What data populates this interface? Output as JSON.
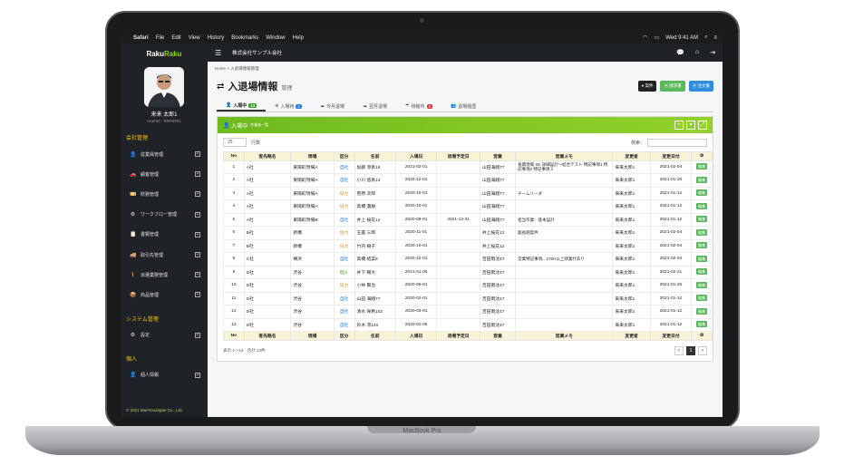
{
  "macbar": {
    "apple": "",
    "app": "Safari",
    "menus": [
      "File",
      "Edit",
      "View",
      "History",
      "Bookmarks",
      "Window",
      "Help"
    ],
    "clock": "Wed 9:41 AM"
  },
  "brand": "MacBook Pro",
  "sidebar": {
    "logo_a": "Raku",
    "logo_b": "Raku",
    "user_name": "来来 太郎1",
    "user_id": "UserID：RR00001",
    "sections": [
      {
        "title": "会社管理",
        "items": [
          {
            "icon": "user-icon",
            "glyph": "👤",
            "label": "従業員管理"
          },
          {
            "icon": "car-icon",
            "glyph": "🚗",
            "label": "顧客管理"
          },
          {
            "icon": "money-icon",
            "glyph": "💴",
            "label": "財務管理"
          },
          {
            "icon": "workflow-icon",
            "glyph": "⚙",
            "label": "ワークフロー管理"
          },
          {
            "icon": "report-icon",
            "glyph": "📋",
            "label": "書類管理"
          },
          {
            "icon": "partner-icon",
            "glyph": "🚚",
            "label": "取引先管理"
          },
          {
            "icon": "dispatch-icon",
            "glyph": "🚶",
            "label": "派遣業務管理"
          },
          {
            "icon": "product-icon",
            "glyph": "📦",
            "label": "商品管理"
          }
        ]
      },
      {
        "title": "システム管理",
        "items": [
          {
            "icon": "settings-icon",
            "glyph": "⚙",
            "label": "設定"
          }
        ]
      },
      {
        "title": "個人",
        "items": [
          {
            "icon": "profile-icon",
            "glyph": "👤",
            "label": "個人情報"
          }
        ]
      }
    ],
    "copyright": "© 2021 ManYouJapan Co., Ltd."
  },
  "topbar": {
    "company": "株式会社サンプル会社"
  },
  "breadcrumb": {
    "home": "Home",
    "sep": ">",
    "current": "入退場情報管理"
  },
  "page": {
    "title": "入退場情報",
    "subtitle": "管理"
  },
  "buttons": [
    {
      "label": "案件",
      "color": "#222222"
    },
    {
      "label": "請求書",
      "color": "#5cb85c"
    },
    {
      "label": "注文書",
      "color": "#2f8ee0"
    }
  ],
  "tabs": [
    {
      "label": "入場中",
      "count": "13",
      "badge": "#3a9d23"
    },
    {
      "label": "入場待",
      "count": "1",
      "badge": "#2f7fe0"
    },
    {
      "label": "今月退場",
      "count": ""
    },
    {
      "label": "翌月退場",
      "count": ""
    },
    {
      "label": "待機中",
      "count": "2",
      "badge": "#d9363e"
    },
    {
      "label": "退場履歴",
      "count": ""
    }
  ],
  "panel": {
    "title": "入場中",
    "subtitle": "作業者一覧"
  },
  "controls": {
    "length": "25",
    "length_label": "行数",
    "search_label": "検索："
  },
  "columns": [
    "No",
    "客先略名",
    "現場",
    "区分",
    "名前",
    "入場日",
    "退場予定日",
    "営業",
    "営業メモ",
    "変更者",
    "変更日付",
    ""
  ],
  "rows": [
    {
      "no": "1",
      "client": "A社",
      "site": "東陽町現場A",
      "kbn": "自社",
      "ktype": "jisha",
      "name": "加藤 涼真16",
      "in": "2021-02-01",
      "out": "",
      "sales": "山田海翔77",
      "memo": "長期現場 SE 詳細設計〜結合テスト 特記事項1 特記事項2 特記事項３",
      "by": "来来太郎1",
      "date": "2021-02-04"
    },
    {
      "no": "2",
      "client": "A社",
      "site": "東陽町現場A",
      "kbn": "自社",
      "ktype": "jisha",
      "name": "小川 悠真13",
      "in": "2020-12-01",
      "out": "",
      "sales": "山田海翔77",
      "memo": "",
      "by": "来来太郎1",
      "date": "2021-01-26"
    },
    {
      "no": "3",
      "client": "A社",
      "site": "東陽町現場A",
      "kbn": "協力",
      "ktype": "kyo",
      "name": "菅原 次郎",
      "in": "2020-10-01",
      "out": "",
      "sales": "山田海翔77",
      "memo": "チームリーダ",
      "by": "来来太郎1",
      "date": "2021-01-12"
    },
    {
      "no": "4",
      "client": "A社",
      "site": "東陽町現場A",
      "kbn": "協力",
      "ktype": "kyo",
      "name": "高橋 遺樹",
      "in": "2020-10-01",
      "out": "",
      "sales": "山田海翔77",
      "memo": "",
      "by": "来来太郎1",
      "date": "2021-01-12"
    },
    {
      "no": "5",
      "client": "A社",
      "site": "東陽町現場B",
      "kbn": "自社",
      "ktype": "jisha",
      "name": "井上 桜花12",
      "in": "2020-08-01",
      "out": "2021-12-31",
      "sales": "山田海翔77",
      "memo": "担当作業：基本設計",
      "by": "来来太郎1",
      "date": "2021-01-12"
    },
    {
      "no": "6",
      "client": "B社",
      "site": "新橋",
      "kbn": "協力",
      "ktype": "kyo",
      "name": "玉置 三郎",
      "in": "2020-11-01",
      "out": "",
      "sales": "井上桜花12",
      "memo": "超長期案件",
      "by": "来来太郎1",
      "date": "2021-02-04"
    },
    {
      "no": "7",
      "client": "B社",
      "site": "新橋",
      "kbn": "協力",
      "ktype": "kyo",
      "name": "竹内 樹子",
      "in": "2020-10-01",
      "out": "",
      "sales": "井上桜花12",
      "memo": "",
      "by": "来来太郎1",
      "date": "2021-02-04"
    },
    {
      "no": "8",
      "client": "C社",
      "site": "横浜",
      "kbn": "自社",
      "ktype": "jisha",
      "name": "高橋 結菜8",
      "in": "2020-12-01",
      "out": "",
      "sales": "吉田雨沈47",
      "memo": "営業特記事項、170H以上残業代あり",
      "by": "来来太郎1",
      "date": "2021-02-04"
    },
    {
      "no": "9",
      "client": "D社",
      "site": "渋谷",
      "kbn": "個人",
      "ktype": "kojin",
      "name": "井下 暢大",
      "in": "2021-01-05",
      "out": "",
      "sales": "吉田雨沈47",
      "memo": "",
      "by": "来来太郎1",
      "date": "2021-02-21"
    },
    {
      "no": "10",
      "client": "D社",
      "site": "渋谷",
      "kbn": "協力",
      "ktype": "kyo",
      "name": "小林 賢治",
      "in": "2020-05-01",
      "out": "",
      "sales": "吉田雨沈47",
      "memo": "",
      "by": "来来太郎1",
      "date": "2021-01-26"
    },
    {
      "no": "11",
      "client": "D社",
      "site": "渋谷",
      "kbn": "自社",
      "ktype": "jisha",
      "name": "山田 海翔77",
      "in": "2020-02-01",
      "out": "",
      "sales": "吉田雨沈47",
      "memo": "",
      "by": "来来太郎1",
      "date": "2021-01-12"
    },
    {
      "no": "12",
      "client": "D社",
      "site": "渋谷",
      "kbn": "自社",
      "ktype": "jisha",
      "name": "清水 咲希102",
      "in": "2020-03-01",
      "out": "",
      "sales": "吉田雨沈47",
      "memo": "",
      "by": "来来太郎1",
      "date": "2021-01-12"
    },
    {
      "no": "13",
      "client": "D社",
      "site": "渋谷",
      "kbn": "自社",
      "ktype": "jisha",
      "name": "鈴木 凛140",
      "in": "2020-01-05",
      "out": "",
      "sales": "吉田雨沈47",
      "memo": "",
      "by": "来来太郎1",
      "date": "2021-01-12"
    }
  ],
  "edit_label": "編集",
  "footer": {
    "info": "表示:1〜13　合計:13件",
    "page": "1",
    "prev": "<",
    "next": ">"
  }
}
